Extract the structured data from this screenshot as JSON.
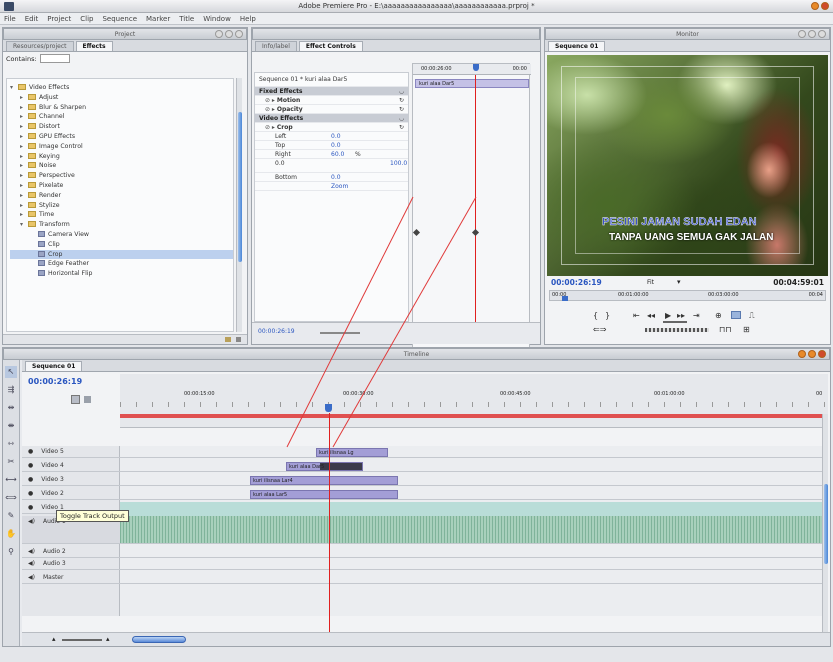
{
  "app": {
    "title": "Adobe Premiere Pro - E:\\aaaaaaaaaaaaaaaa\\aaaaaaaaaaaa.prproj *",
    "menus": [
      "File",
      "Edit",
      "Project",
      "Clip",
      "Sequence",
      "Marker",
      "Title",
      "Window",
      "Help"
    ]
  },
  "project_panel": {
    "header": "Project",
    "tabs": [
      "Resources/project",
      "Effects"
    ],
    "contains_label": "Contains:",
    "tree": [
      {
        "label": "Video Effects",
        "level": 0,
        "open": true
      },
      {
        "label": "Adjust",
        "level": 1
      },
      {
        "label": "Blur & Sharpen",
        "level": 1
      },
      {
        "label": "Channel",
        "level": 1
      },
      {
        "label": "Distort",
        "level": 1
      },
      {
        "label": "GPU Effects",
        "level": 1
      },
      {
        "label": "Image Control",
        "level": 1
      },
      {
        "label": "Keying",
        "level": 1
      },
      {
        "label": "Noise",
        "level": 1
      },
      {
        "label": "Perspective",
        "level": 1
      },
      {
        "label": "Pixelate",
        "level": 1
      },
      {
        "label": "Render",
        "level": 1
      },
      {
        "label": "Stylize",
        "level": 1
      },
      {
        "label": "Time",
        "level": 1
      },
      {
        "label": "Transform",
        "level": 1,
        "open": true
      },
      {
        "label": "Camera View",
        "level": 2
      },
      {
        "label": "Clip",
        "level": 2
      },
      {
        "label": "Crop",
        "level": 2,
        "selected": true
      },
      {
        "label": "Edge Feather",
        "level": 2
      },
      {
        "label": "Horizontal Flip",
        "level": 2
      }
    ]
  },
  "effect_controls": {
    "tabs": [
      "Info/label",
      "Effect Controls"
    ],
    "sequence_line": "Sequence 01 * kuri alaa Dar5",
    "timecode_left": "00:00:26:00",
    "timecode_right": "00:00",
    "clip_label": "kuri alaa Dar5",
    "rows": [
      {
        "label": "Fixed Effects",
        "type": "section"
      },
      {
        "label": "Motion",
        "type": "fx"
      },
      {
        "label": "Opacity",
        "type": "fx"
      },
      {
        "label": "Video Effects",
        "type": "section"
      },
      {
        "label": "Crop",
        "type": "fx"
      },
      {
        "label": "Left",
        "value": "0.0",
        "type": "param"
      },
      {
        "label": "Top",
        "value": "0.0",
        "type": "param"
      },
      {
        "label": "Right",
        "value": "60.0",
        "unit": "%",
        "type": "param"
      },
      {
        "label": "0.0",
        "value": "100.0",
        "type": "range"
      },
      {
        "label": "Bottom",
        "value": "0.0",
        "type": "param"
      },
      {
        "label": "",
        "value": "Zoom",
        "type": "check"
      }
    ],
    "bottom_timecode": "00:00:26:19"
  },
  "monitor": {
    "panel_title": "Monitor",
    "tab": "Sequence 01",
    "subtitle_line1": "PESINI JAMAN SUDAH EDAN",
    "subtitle_line2": "TANPA UANG SEMUA GAK JALAN",
    "timecode_current": "00:00:26:19",
    "fit": "Fit",
    "timecode_duration": "00:04:59:01",
    "ruler": [
      "00:00",
      "00:01:00:00",
      "00:03:00:00",
      "00:04"
    ]
  },
  "timeline": {
    "panel_title": "Timeline",
    "tab": "Sequence 01",
    "timecode": "00:00:26:19",
    "ruler": [
      "00:00:15:00",
      "00:00:30:00",
      "00:00:45:00",
      "00:01:00:00",
      "00"
    ],
    "tracks": [
      "Video 5",
      "Video 4",
      "Video 3",
      "Video 2",
      "Video 1",
      "Audio 1",
      "Audio 2",
      "Audio 3",
      "Master"
    ],
    "clips": [
      {
        "label": "kuri ilisnaa Lg",
        "track": 0
      },
      {
        "label": "kuri alaa Dar5",
        "track": 1
      },
      {
        "label": "kuri ilisnaa Lar4",
        "track": 2
      },
      {
        "label": "kuri alaa Lar5",
        "track": 3
      }
    ],
    "tooltip": "Toggle Track Output"
  },
  "colors": {
    "clip_purple": "#a39ed6",
    "clip_selected": "#3a3a4a",
    "video1_bg": "#b9ddd8",
    "audio_green": "#7fb39a",
    "playhead_red": "#e02020",
    "ec_playhead": "#3a6cc8"
  }
}
